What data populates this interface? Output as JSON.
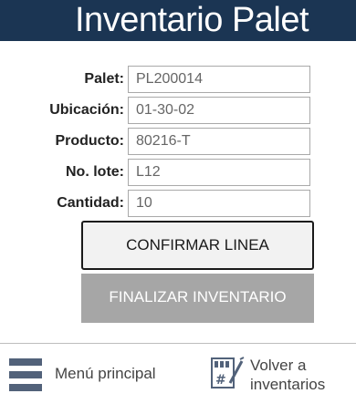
{
  "header": {
    "title": "Inventario Palet"
  },
  "form": {
    "fields": [
      {
        "label": "Palet:",
        "value": "PL200014"
      },
      {
        "label": "Ubicación:",
        "value": "01-30-02"
      },
      {
        "label": "Producto:",
        "value": "80216-T"
      },
      {
        "label": "No. lote:",
        "value": "L12"
      },
      {
        "label": "Cantidad:",
        "value": "10"
      }
    ]
  },
  "buttons": {
    "confirm_label": "CONFIRMAR LINEA",
    "finish_label": "FINALIZAR INVENTARIO"
  },
  "footer": {
    "menu_label": "Menú principal",
    "back_label": "Volver a inventarios",
    "menu_icon": "hamburger-icon",
    "back_icon": "inventory-sheet-icon"
  },
  "colors": {
    "header_bg": "#1b3553",
    "disabled_button_bg": "#a6a6a6",
    "icon_color": "#52627a"
  }
}
